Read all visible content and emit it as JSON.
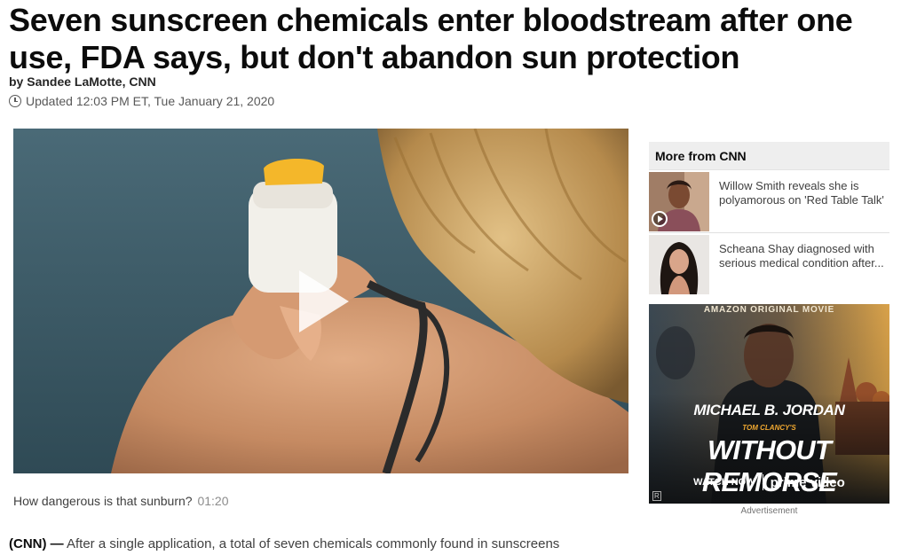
{
  "article": {
    "headline": "Seven sunscreen chemicals enter bloodstream after one use, FDA says, but don't abandon sun protection",
    "byline_prefix": "by ",
    "author": "Sandee LaMotte, CNN",
    "updated": "Updated 12:03 PM ET, Tue January 21, 2020",
    "video_caption": "How dangerous is that sunburn?",
    "video_duration": "01:20",
    "body_source": "(CNN) —",
    "body_text": " After a single application, a total of seven chemicals commonly found in sunscreens"
  },
  "sidebar": {
    "header": "More from CNN",
    "items": [
      {
        "title": "Willow Smith reveals she is polyamorous on 'Red Table Talk'",
        "has_video": true
      },
      {
        "title": "Scheana Shay diagnosed with serious medical condition after...",
        "has_video": false
      }
    ]
  },
  "ad": {
    "top_line": "AMAZON ORIGINAL MOVIE",
    "actor": "MICHAEL B. JORDAN",
    "series": "TOM CLANCY'S",
    "title": "WITHOUT REMORSE",
    "cta": "WATCH NOW",
    "brand": "prime video",
    "rating": "R",
    "label": "Advertisement"
  },
  "colors": {
    "sea": "#3d5965",
    "skin": "#c98d66",
    "hair": "#c49a5a",
    "ad_bg": "#2a2d30",
    "ad_accent": "#f0a830"
  },
  "icons": {
    "updated": "clock-icon",
    "video": "play-icon"
  }
}
